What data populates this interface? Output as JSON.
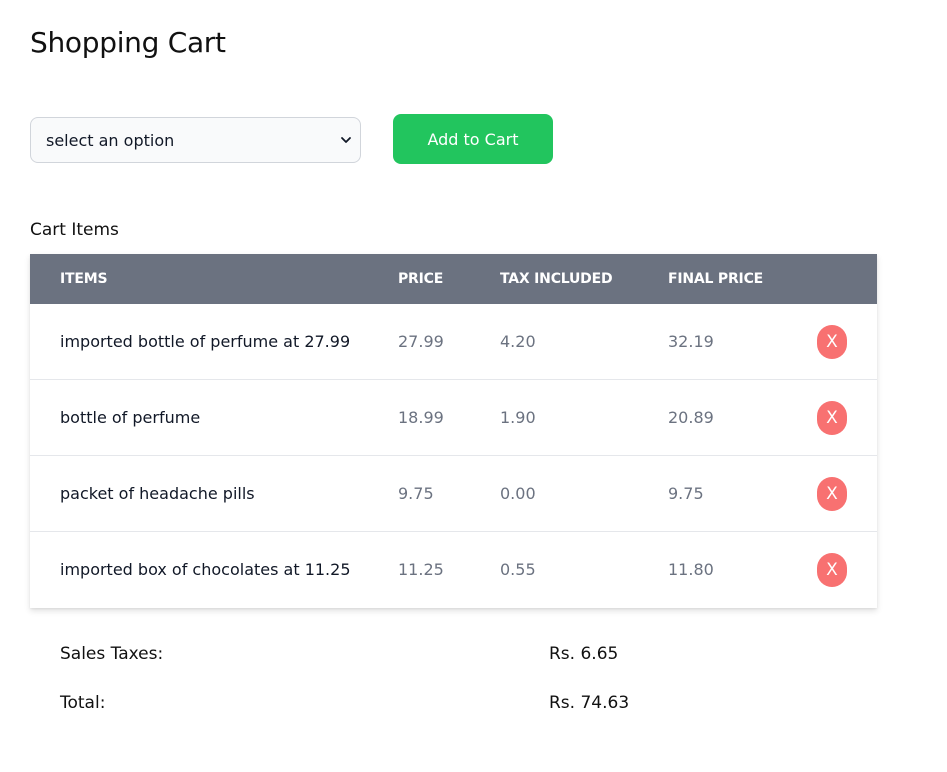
{
  "page": {
    "title": "Shopping Cart"
  },
  "controls": {
    "select": {
      "selected": "select an option",
      "icon": "chevron-down-icon"
    },
    "add_button_label": "Add to Cart"
  },
  "cart": {
    "heading": "Cart Items",
    "columns": [
      "ITEMS",
      "PRICE",
      "TAX INCLUDED",
      "FINAL PRICE"
    ],
    "rows": [
      {
        "item": "imported bottle of perfume at 27.99",
        "price": "27.99",
        "tax": "4.20",
        "final": "32.19",
        "remove_label": "X"
      },
      {
        "item": "bottle of perfume",
        "price": "18.99",
        "tax": "1.90",
        "final": "20.89",
        "remove_label": "X"
      },
      {
        "item": "packet of headache pills",
        "price": "9.75",
        "tax": "0.00",
        "final": "9.75",
        "remove_label": "X"
      },
      {
        "item": "imported box of chocolates at 11.25",
        "price": "11.25",
        "tax": "0.55",
        "final": "11.80",
        "remove_label": "X"
      }
    ]
  },
  "summary": {
    "sales_taxes_label": "Sales Taxes:",
    "sales_taxes_value": "Rs. 6.65",
    "total_label": "Total:",
    "total_value": "Rs. 74.63"
  },
  "colors": {
    "accent_green": "#22c55e",
    "header_gray": "#6b7280",
    "remove_red": "#f87171"
  }
}
